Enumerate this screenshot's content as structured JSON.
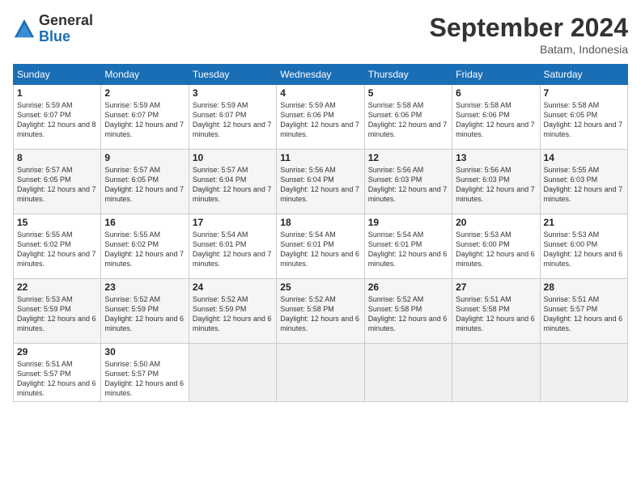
{
  "logo": {
    "general": "General",
    "blue": "Blue"
  },
  "title": "September 2024",
  "location": "Batam, Indonesia",
  "days_header": [
    "Sunday",
    "Monday",
    "Tuesday",
    "Wednesday",
    "Thursday",
    "Friday",
    "Saturday"
  ],
  "weeks": [
    [
      {
        "day": "1",
        "sunrise": "5:59 AM",
        "sunset": "6:07 PM",
        "daylight": "12 hours and 8 minutes."
      },
      {
        "day": "2",
        "sunrise": "5:59 AM",
        "sunset": "6:07 PM",
        "daylight": "12 hours and 7 minutes."
      },
      {
        "day": "3",
        "sunrise": "5:59 AM",
        "sunset": "6:07 PM",
        "daylight": "12 hours and 7 minutes."
      },
      {
        "day": "4",
        "sunrise": "5:59 AM",
        "sunset": "6:06 PM",
        "daylight": "12 hours and 7 minutes."
      },
      {
        "day": "5",
        "sunrise": "5:58 AM",
        "sunset": "6:06 PM",
        "daylight": "12 hours and 7 minutes."
      },
      {
        "day": "6",
        "sunrise": "5:58 AM",
        "sunset": "6:06 PM",
        "daylight": "12 hours and 7 minutes."
      },
      {
        "day": "7",
        "sunrise": "5:58 AM",
        "sunset": "6:05 PM",
        "daylight": "12 hours and 7 minutes."
      }
    ],
    [
      {
        "day": "8",
        "sunrise": "5:57 AM",
        "sunset": "6:05 PM",
        "daylight": "12 hours and 7 minutes."
      },
      {
        "day": "9",
        "sunrise": "5:57 AM",
        "sunset": "6:05 PM",
        "daylight": "12 hours and 7 minutes."
      },
      {
        "day": "10",
        "sunrise": "5:57 AM",
        "sunset": "6:04 PM",
        "daylight": "12 hours and 7 minutes."
      },
      {
        "day": "11",
        "sunrise": "5:56 AM",
        "sunset": "6:04 PM",
        "daylight": "12 hours and 7 minutes."
      },
      {
        "day": "12",
        "sunrise": "5:56 AM",
        "sunset": "6:03 PM",
        "daylight": "12 hours and 7 minutes."
      },
      {
        "day": "13",
        "sunrise": "5:56 AM",
        "sunset": "6:03 PM",
        "daylight": "12 hours and 7 minutes."
      },
      {
        "day": "14",
        "sunrise": "5:55 AM",
        "sunset": "6:03 PM",
        "daylight": "12 hours and 7 minutes."
      }
    ],
    [
      {
        "day": "15",
        "sunrise": "5:55 AM",
        "sunset": "6:02 PM",
        "daylight": "12 hours and 7 minutes."
      },
      {
        "day": "16",
        "sunrise": "5:55 AM",
        "sunset": "6:02 PM",
        "daylight": "12 hours and 7 minutes."
      },
      {
        "day": "17",
        "sunrise": "5:54 AM",
        "sunset": "6:01 PM",
        "daylight": "12 hours and 7 minutes."
      },
      {
        "day": "18",
        "sunrise": "5:54 AM",
        "sunset": "6:01 PM",
        "daylight": "12 hours and 6 minutes."
      },
      {
        "day": "19",
        "sunrise": "5:54 AM",
        "sunset": "6:01 PM",
        "daylight": "12 hours and 6 minutes."
      },
      {
        "day": "20",
        "sunrise": "5:53 AM",
        "sunset": "6:00 PM",
        "daylight": "12 hours and 6 minutes."
      },
      {
        "day": "21",
        "sunrise": "5:53 AM",
        "sunset": "6:00 PM",
        "daylight": "12 hours and 6 minutes."
      }
    ],
    [
      {
        "day": "22",
        "sunrise": "5:53 AM",
        "sunset": "5:59 PM",
        "daylight": "12 hours and 6 minutes."
      },
      {
        "day": "23",
        "sunrise": "5:52 AM",
        "sunset": "5:59 PM",
        "daylight": "12 hours and 6 minutes."
      },
      {
        "day": "24",
        "sunrise": "5:52 AM",
        "sunset": "5:59 PM",
        "daylight": "12 hours and 6 minutes."
      },
      {
        "day": "25",
        "sunrise": "5:52 AM",
        "sunset": "5:58 PM",
        "daylight": "12 hours and 6 minutes."
      },
      {
        "day": "26",
        "sunrise": "5:52 AM",
        "sunset": "5:58 PM",
        "daylight": "12 hours and 6 minutes."
      },
      {
        "day": "27",
        "sunrise": "5:51 AM",
        "sunset": "5:58 PM",
        "daylight": "12 hours and 6 minutes."
      },
      {
        "day": "28",
        "sunrise": "5:51 AM",
        "sunset": "5:57 PM",
        "daylight": "12 hours and 6 minutes."
      }
    ],
    [
      {
        "day": "29",
        "sunrise": "5:51 AM",
        "sunset": "5:57 PM",
        "daylight": "12 hours and 6 minutes."
      },
      {
        "day": "30",
        "sunrise": "5:50 AM",
        "sunset": "5:57 PM",
        "daylight": "12 hours and 6 minutes."
      },
      null,
      null,
      null,
      null,
      null
    ]
  ]
}
